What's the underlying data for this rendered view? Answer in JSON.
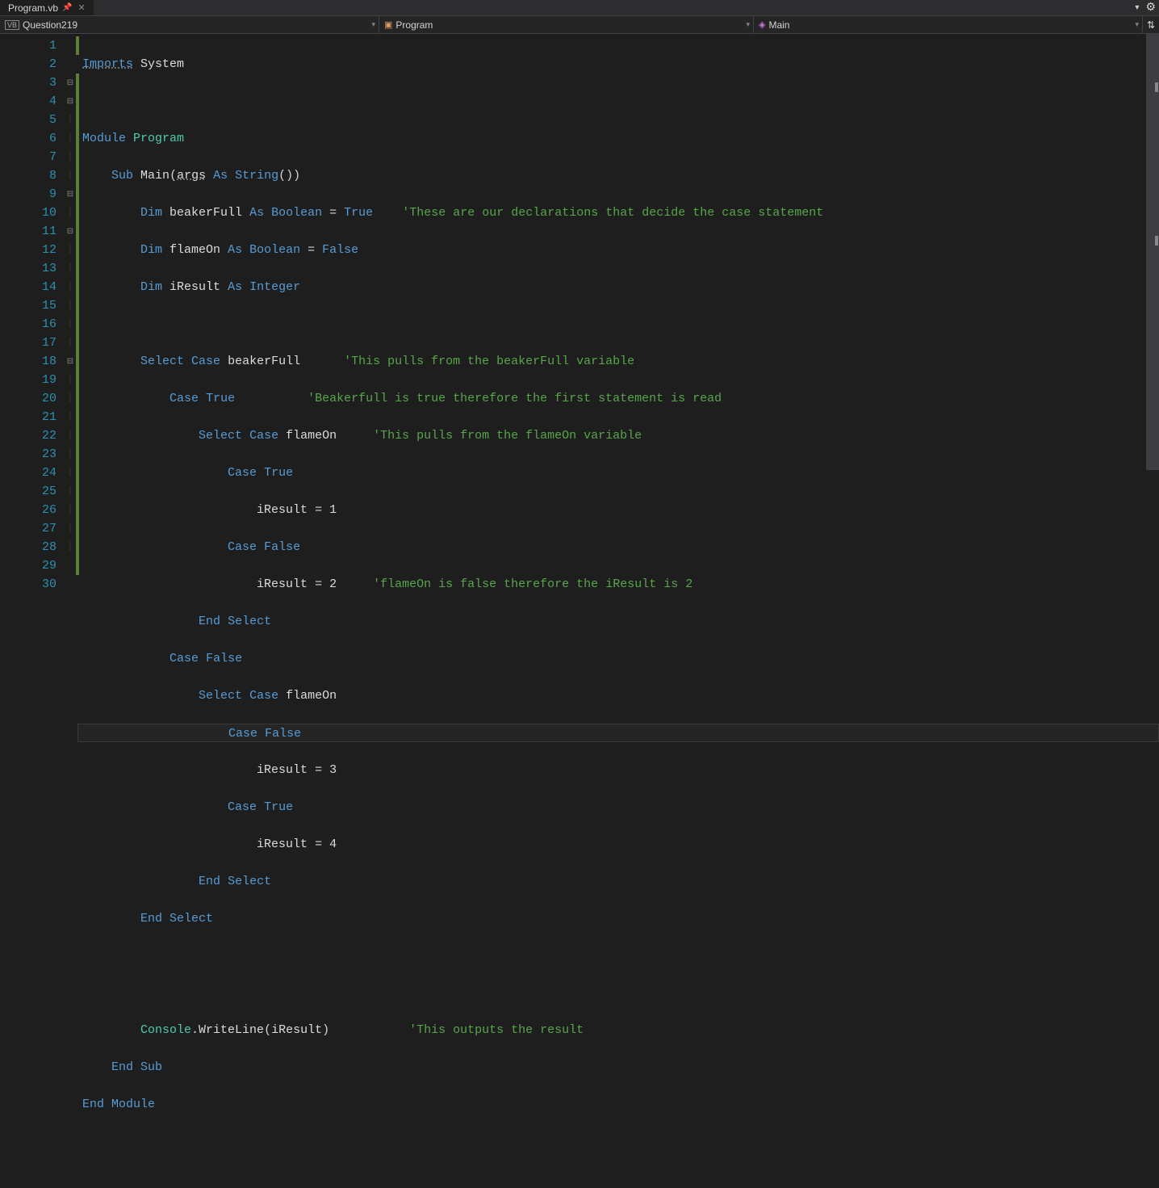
{
  "tab": {
    "filename": "Program.vb"
  },
  "dropdowns": {
    "project": "Question219",
    "class": "Program",
    "method": "Main"
  },
  "lineNumbers": [
    "1",
    "2",
    "3",
    "4",
    "5",
    "6",
    "7",
    "8",
    "9",
    "10",
    "11",
    "12",
    "13",
    "14",
    "15",
    "16",
    "17",
    "18",
    "19",
    "20",
    "21",
    "22",
    "23",
    "24",
    "25",
    "26",
    "27",
    "28",
    "29",
    "30"
  ],
  "code": {
    "l1": {
      "imports": "Imports",
      "system": "System"
    },
    "l3": {
      "module": "Module",
      "program": "Program"
    },
    "l4": {
      "sub": "Sub",
      "main": "Main",
      "args": "args",
      "as": "As",
      "string": "String"
    },
    "l5": {
      "dim": "Dim",
      "var": "beakerFull",
      "as": "As",
      "type": "Boolean",
      "eq": "=",
      "val": "True",
      "cmt": "'These are our declarations that decide the case statement"
    },
    "l6": {
      "dim": "Dim",
      "var": "flameOn",
      "as": "As",
      "type": "Boolean",
      "eq": "=",
      "val": "False"
    },
    "l7": {
      "dim": "Dim",
      "var": "iResult",
      "as": "As",
      "type": "Integer"
    },
    "l9": {
      "select": "Select",
      "case": "Case",
      "var": "beakerFull",
      "cmt": "'This pulls from the beakerFull variable"
    },
    "l10": {
      "case": "Case",
      "val": "True",
      "cmt": "'Beakerfull is true therefore the first statement is read"
    },
    "l11": {
      "select": "Select",
      "case": "Case",
      "var": "flameOn",
      "cmt": "'This pulls from the flameOn variable"
    },
    "l12": {
      "case": "Case",
      "val": "True"
    },
    "l13": {
      "var": "iResult",
      "eq": "=",
      "val": "1"
    },
    "l14": {
      "case": "Case",
      "val": "False"
    },
    "l15": {
      "var": "iResult",
      "eq": "=",
      "val": "2",
      "cmt": "'flameOn is false therefore the iResult is 2"
    },
    "l16": {
      "end": "End",
      "select": "Select"
    },
    "l17": {
      "case": "Case",
      "val": "False"
    },
    "l18": {
      "select": "Select",
      "case": "Case",
      "var": "flameOn"
    },
    "l19": {
      "case": "Case",
      "val": "False"
    },
    "l20": {
      "var": "iResult",
      "eq": "=",
      "val": "3"
    },
    "l21": {
      "case": "Case",
      "val": "True"
    },
    "l22": {
      "var": "iResult",
      "eq": "=",
      "val": "4"
    },
    "l23": {
      "end": "End",
      "select": "Select"
    },
    "l24": {
      "end": "End",
      "select": "Select"
    },
    "l27": {
      "console": "Console",
      "write": "WriteLine",
      "var": "iResult",
      "cmt": "'This outputs the result"
    },
    "l28": {
      "end": "End",
      "sub": "Sub"
    },
    "l29": {
      "end": "End",
      "module": "Module"
    }
  },
  "currentLine": 19
}
